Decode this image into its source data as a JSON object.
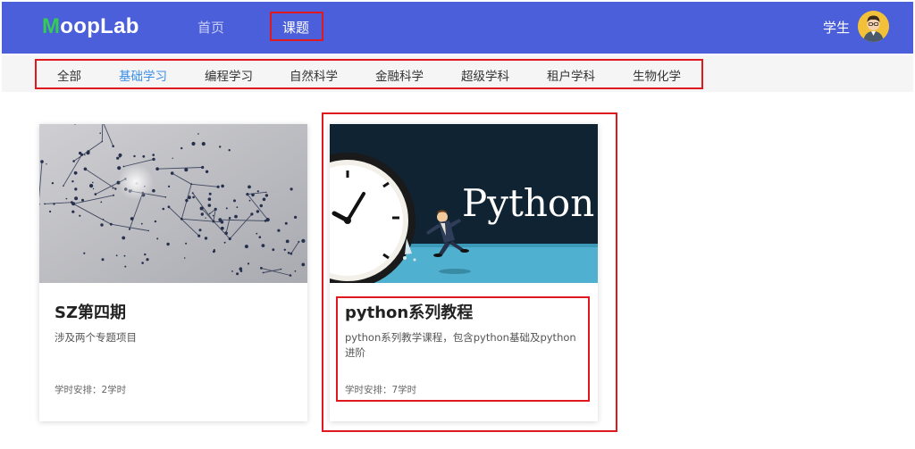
{
  "header": {
    "logo_first": "M",
    "logo_rest": "oopLab",
    "nav": {
      "home": "首页",
      "courses": "课题"
    },
    "user": "学生",
    "colors": {
      "bar": "#4a5fd9",
      "logo_accent": "#33cc55",
      "highlight": "#e0191e"
    }
  },
  "categories": {
    "items": [
      "全部",
      "基础学习",
      "编程学习",
      "自然科学",
      "金融科学",
      "超级学科",
      "租户学科",
      "生物化学"
    ],
    "active": "基础学习",
    "active_color": "#3a8ee6"
  },
  "cards": [
    {
      "title": "SZ第四期",
      "description": "涉及两个专题项目",
      "hours": "学时安排：2学时",
      "image": "network-sphere-image"
    },
    {
      "title": "python系列教程",
      "description": "python系列教学课程，包含python基础及python进阶",
      "hours": "学时安排：7学时",
      "image": "python-clock-runner-image",
      "image_text": "Python"
    }
  ]
}
